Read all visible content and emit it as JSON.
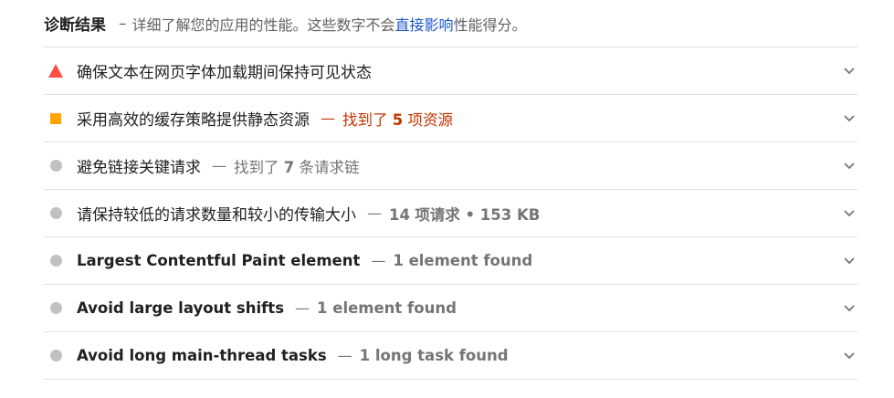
{
  "header": {
    "title": "诊断结果",
    "dash": "–",
    "desc_before": "详细了解您的应用的性能。这些数字不会",
    "link": "直接影响",
    "desc_after": "性能得分。"
  },
  "audits": [
    {
      "title": "确保文本在网页字体加载期间保持可见状态",
      "status": "fail",
      "marker_color": "#ff4e42"
    },
    {
      "title": "采用高效的缓存策略提供静态资源",
      "dash": "—",
      "detail_prefix": "找到了",
      "detail_num": "5",
      "detail_suffix": "项资源",
      "status": "average",
      "marker_color": "#ffa400",
      "detail_color": "#c33300"
    },
    {
      "title": "避免链接关键请求",
      "dash": "—",
      "detail_prefix": "找到了",
      "detail_num": "7",
      "detail_suffix": "条请求链",
      "status": "info"
    },
    {
      "title": "请保持较低的请求数量和较小的传输大小",
      "dash": "—",
      "detail_num": "14",
      "detail_suffix": "项请求 • 153 KB",
      "status": "info"
    },
    {
      "title": "Largest Contentful Paint element",
      "dash": "—",
      "detail": "1 element found",
      "status": "info"
    },
    {
      "title": "Avoid large layout shifts",
      "dash": "—",
      "detail": "1 element found",
      "status": "info"
    },
    {
      "title": "Avoid long main-thread tasks",
      "dash": "—",
      "detail": "1 long task found",
      "status": "info"
    }
  ],
  "icons": {
    "fail": "triangle-icon",
    "average": "square-icon",
    "info": "circle-icon",
    "expand": "chevron-down-icon"
  },
  "colors": {
    "fail": "#ff4e42",
    "average": "#ffa400",
    "info": "#c1c1c1",
    "link": "#1a54c8",
    "warn_text": "#c33300"
  }
}
